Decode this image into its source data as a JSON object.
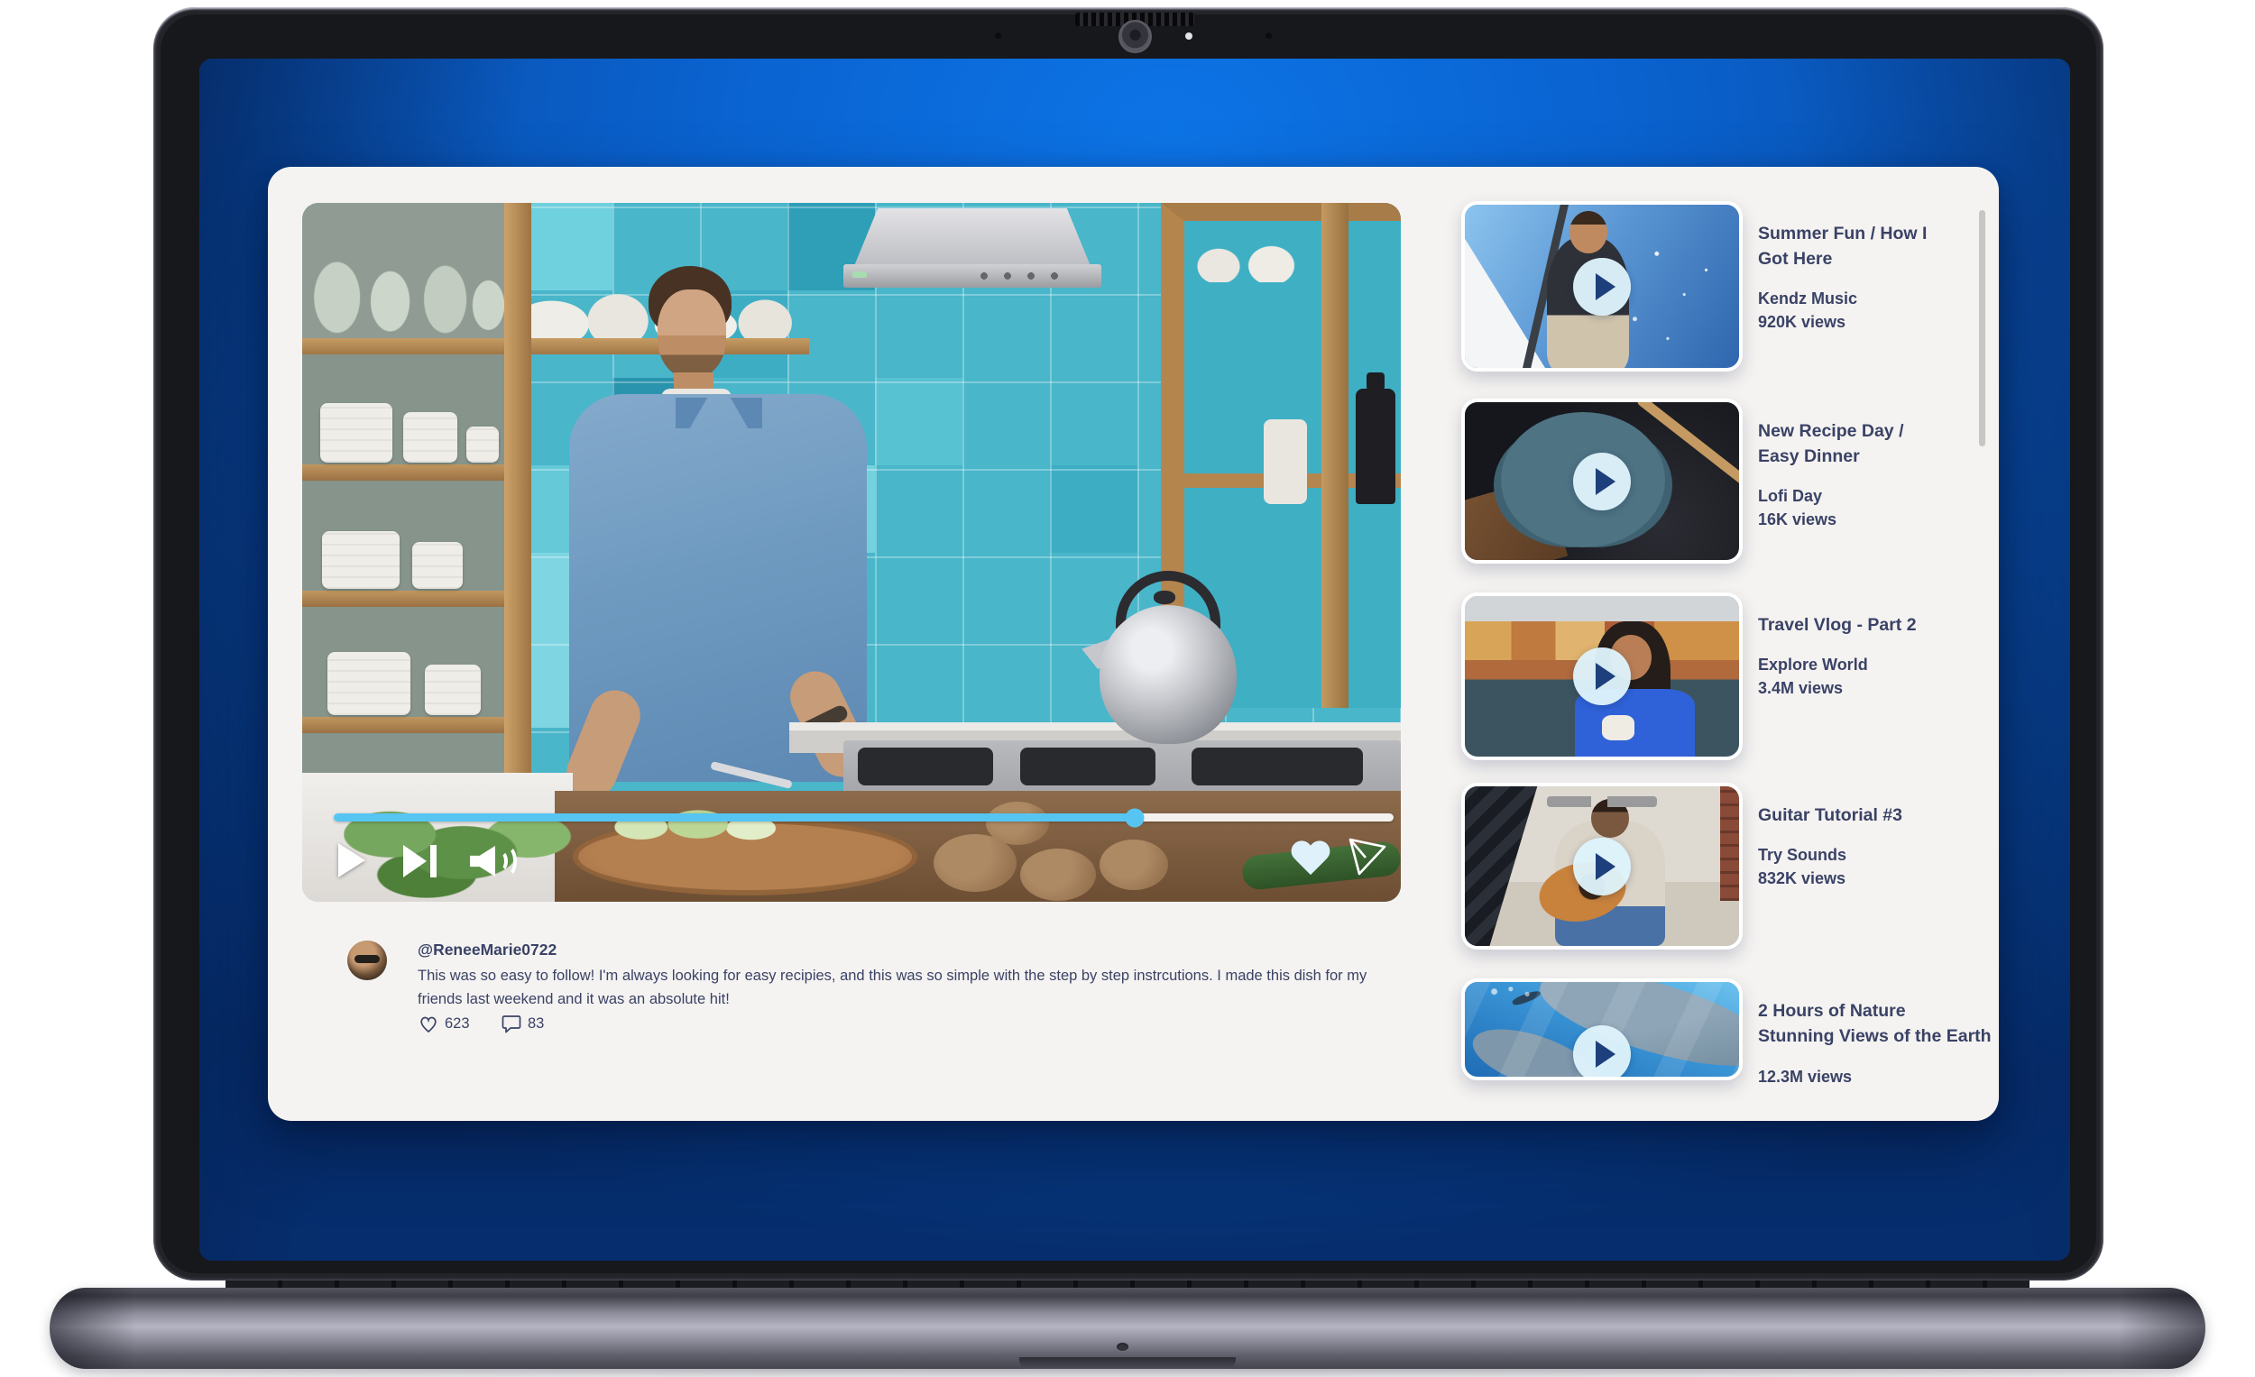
{
  "app": {
    "player": {
      "progress_percent": 75.6,
      "accent_color": "#57c5f2"
    },
    "comment": {
      "username": "@ReneeMarie0722",
      "text": "This was so easy to follow! I'm always looking for easy recipies, and this was so simple with the step by step instrcutions. I made this dish for my friends last weekend and it was an absolute hit!",
      "likes": "623",
      "replies": "83"
    },
    "sidebar": {
      "items": [
        {
          "title_lines": [
            "Summer Fun / How I",
            "Got Here"
          ],
          "channel": "Kendz Music",
          "views": "920K views",
          "thumb": "sailing"
        },
        {
          "title_lines": [
            "New Recipe Day /",
            "Easy Dinner"
          ],
          "channel": "Lofi Day",
          "views": "16K views",
          "thumb": "recipe"
        },
        {
          "title_lines": [
            "Travel Vlog - Part 2"
          ],
          "channel": "Explore World",
          "views": "3.4M views",
          "thumb": "travel"
        },
        {
          "title_lines": [
            "Guitar Tutorial #3"
          ],
          "channel": "Try Sounds",
          "views": "832K views",
          "thumb": "guitar"
        },
        {
          "title_lines": [
            "2 Hours of Nature",
            "Stunning Views of the Earth"
          ],
          "channel": "",
          "views": "12.3M views",
          "thumb": "nature"
        }
      ]
    },
    "colors": {
      "text": "#3a4266",
      "window_bg": "#f5f3f1",
      "wallpaper_bright": "#0d74e6",
      "wallpaper_dark": "#062e6e"
    }
  }
}
